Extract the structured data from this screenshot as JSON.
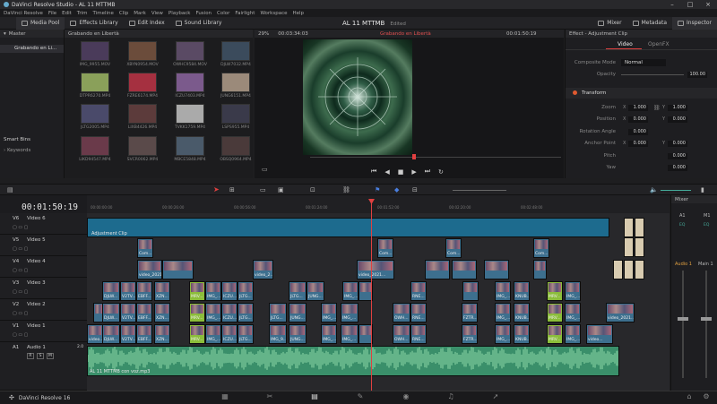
{
  "window": {
    "title": "DaVinci Resolve Studio - AL 11 MTTMB"
  },
  "menu": [
    "DaVinci Resolve",
    "File",
    "Edit",
    "Trim",
    "Timeline",
    "Clip",
    "Mark",
    "View",
    "Playback",
    "Fusion",
    "Color",
    "Fairlight",
    "Workspace",
    "Help"
  ],
  "toolbar": {
    "media_pool": "Media Pool",
    "effects_library": "Effects Library",
    "edit_index": "Edit Index",
    "sound_library": "Sound Library",
    "mixer": "Mixer",
    "metadata": "Metadata",
    "inspector": "Inspector"
  },
  "project": {
    "name": "AL 11 MTTMB",
    "status": "Edited"
  },
  "pool": {
    "bin_header": "Grabando en Libertà",
    "master": "Master",
    "bin_item": "Grabando en Li...",
    "smart_bins": "Smart Bins",
    "keywords": "Keywords",
    "clips": [
      {
        "name": "IMG_9955.MOV",
        "c": "#4a3b5a"
      },
      {
        "name": "XBYN0954.MOV",
        "c": "#6b4c3b"
      },
      {
        "name": "OWHC9584.MOV",
        "c": "#5a4a64"
      },
      {
        "name": "DJLW7032.MP4",
        "c": "#3b4b5c"
      },
      {
        "name": "DTPR6270.MP4",
        "c": "#8aa05a"
      },
      {
        "name": "FZRE6174.MP4",
        "c": "#a53040"
      },
      {
        "name": "ICZU7403.MP4",
        "c": "#7b5a8c"
      },
      {
        "name": "JUNG6151.MP4",
        "c": "#9b8a7a"
      },
      {
        "name": "JLTG2005.MP4",
        "c": "#4a4a6a"
      },
      {
        "name": "LIXB4426.MP4",
        "c": "#5c3b3b"
      },
      {
        "name": "TVKK1759.MP4",
        "c": "#aaaaaa"
      },
      {
        "name": "LSPS955.MP4",
        "c": "#3a3a4a"
      },
      {
        "name": "LIKD94547.MP4",
        "c": "#6a3a4a"
      },
      {
        "name": "SVCR0062.MP4",
        "c": "#5a4a4a"
      },
      {
        "name": "MBCE5848.MP4",
        "c": "#4a5a6a"
      },
      {
        "name": "OBSQ0964.MP4",
        "c": "#4a3a3a"
      }
    ]
  },
  "viewer": {
    "zoom": "29%",
    "timecode_in": "00:03:34:03",
    "clip_name": "Grabando en Libertà",
    "timecode_out": "00:01:50:19"
  },
  "inspector": {
    "title": "Effect - Adjustment Clip",
    "tab_video": "Video",
    "tab_openfx": "OpenFX",
    "composite_mode_label": "Composite Mode",
    "composite_mode_value": "Normal",
    "opacity_label": "Opacity",
    "opacity_value": "100.00",
    "transform_label": "Transform",
    "zoom_label": "Zoom",
    "zoom_x": "1.000",
    "zoom_y": "1.000",
    "position_label": "Position",
    "position_x": "0.000",
    "position_y": "0.000",
    "rotation_label": "Rotation Angle",
    "rotation_value": "0.000",
    "anchor_label": "Anchor Point",
    "anchor_x": "0.000",
    "anchor_y": "0.000",
    "pitch_label": "Pitch",
    "pitch_value": "0.000",
    "yaw_label": "Yaw",
    "yaw_value": "0.000"
  },
  "timeline": {
    "timecode": "00:01:50:19",
    "ruler": [
      "00:00:00:00",
      "00:00:26:00",
      "00:00:56:00",
      "00:01:24:00",
      "00:01:52:00",
      "00:02:20:00",
      "00:02:48:00"
    ],
    "tracks": {
      "v6": {
        "id": "V6",
        "name": "Video 6"
      },
      "v5": {
        "id": "V5",
        "name": "Video 5"
      },
      "v4": {
        "id": "V4",
        "name": "Video 4"
      },
      "v3": {
        "id": "V3",
        "name": "Video 3"
      },
      "v2": {
        "id": "V2",
        "name": "Video 2"
      },
      "v1": {
        "id": "V1",
        "name": "Video 1"
      },
      "a1": {
        "id": "A1",
        "name": "Audio 1",
        "level": "2.0",
        "buttons": [
          "R",
          "S",
          "M"
        ]
      }
    },
    "adjustment_clip": "Adjustment Clip",
    "audio_clip": "AL 11 MTTMB con voz.mp3",
    "clip_labels": {
      "com": "Com...",
      "video2021": "video_2021...",
      "video2": "video_2...",
      "v3a": "DJLW...",
      "v3b": "V2TV...",
      "v3c": "EBFF...",
      "v3d": "XZN...",
      "mrv": "MRV...",
      "img": "IMG_...",
      "icz": "ICZU...",
      "jlt": "JLTG...",
      "jun": "JUNG...",
      "rne": "RNE...",
      "knu": "KNUB...",
      "ovh": "OWH...",
      "fzt": "FZTR...",
      "v1a": "video...",
      "v1b": "IMG_9...",
      "v1c": "video...",
      "v1d": "video_2021-12-11T2...",
      "v1e": "video_2..."
    }
  },
  "mixer": {
    "title": "Mixer",
    "ch1": "A1",
    "ch2": "M1",
    "eq": "EQ",
    "audio": "Audio 1",
    "main": "Main 1"
  },
  "footer": {
    "app": "DaVinci Resolve 16"
  }
}
